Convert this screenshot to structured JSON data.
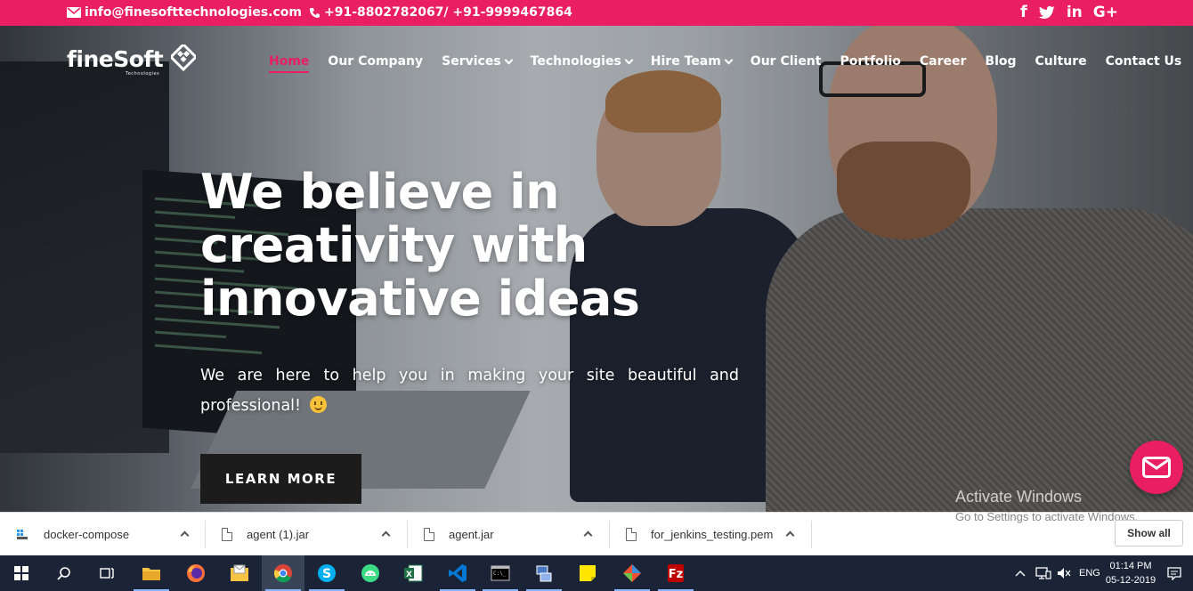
{
  "topbar": {
    "email": "info@finesofttechnologies.com",
    "phones": "+91-8802782067/ +91-9999467864",
    "social": [
      "f",
      "twitter",
      "in",
      "G+"
    ],
    "accent": "#e91e63"
  },
  "logo": {
    "word": "fineSoft",
    "tagline": "Technologies"
  },
  "nav": {
    "items": [
      {
        "label": "Home",
        "active": true
      },
      {
        "label": "Our Company"
      },
      {
        "label": "Services",
        "dropdown": true
      },
      {
        "label": "Technologies",
        "dropdown": true
      },
      {
        "label": "Hire Team",
        "dropdown": true
      },
      {
        "label": "Our Client"
      },
      {
        "label": "Portfolio"
      },
      {
        "label": "Career"
      },
      {
        "label": "Blog"
      },
      {
        "label": "Culture"
      },
      {
        "label": "Contact Us"
      }
    ]
  },
  "hero": {
    "headline_1": "We believe in",
    "headline_2": "creativity with",
    "headline_3": "innovative ideas",
    "subtitle": "We are here to help you in making your site beautiful and professional!",
    "cta": "LEARN MORE"
  },
  "watermark": {
    "title": "Activate Windows",
    "subtitle": "Go to Settings to activate Windows."
  },
  "downloads": {
    "items": [
      {
        "name": "docker-compose"
      },
      {
        "name": "agent (1).jar"
      },
      {
        "name": "agent.jar"
      },
      {
        "name": "for_jenkins_testing.pem"
      }
    ],
    "show_all": "Show all"
  },
  "taskbar": {
    "apps": [
      "file-explorer",
      "firefox",
      "mail-folder",
      "chrome",
      "skype",
      "android-studio",
      "excel",
      "vscode",
      "terminal",
      "network-tool",
      "sticky-notes",
      "git",
      "filezilla"
    ],
    "lang": "ENG",
    "time": "01:14 PM",
    "date": "05-12-2019"
  }
}
